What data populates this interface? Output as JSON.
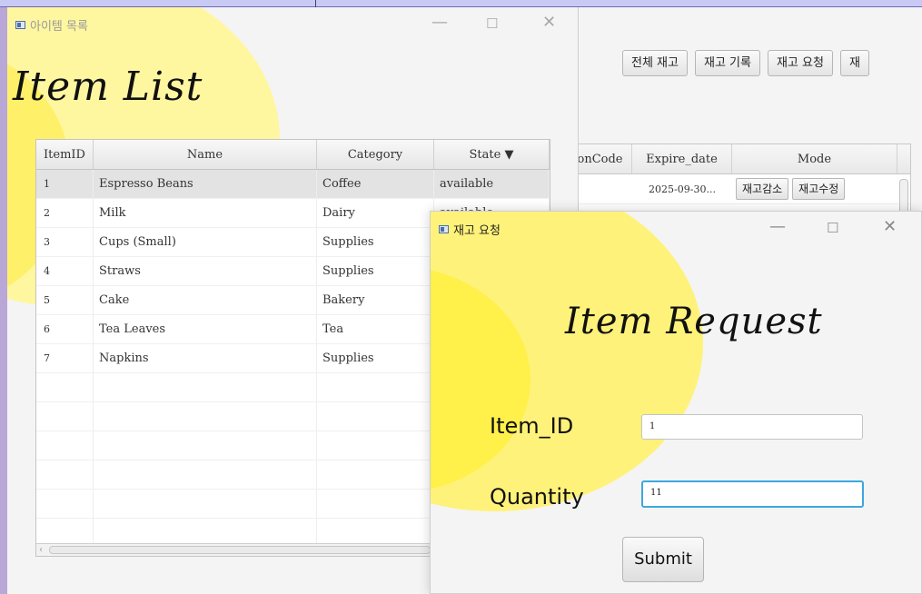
{
  "background_window": {
    "toolbar_buttons": [
      "전체 재고",
      "재고 기록",
      "재고 요청",
      "재"
    ],
    "table_headers": [
      "onCode",
      "Expire_date",
      "Mode"
    ],
    "first_row": {
      "expire_date": "2025-09-30...",
      "decrease_button": "재고감소",
      "edit_button": "재고수정"
    }
  },
  "item_window": {
    "title": "아이템 목록",
    "heading": "Item List",
    "controls": {
      "minimize": "—",
      "maximize": "☐",
      "close": "✕"
    },
    "columns": {
      "id": "ItemID",
      "name": "Name",
      "category": "Category",
      "state": "State ▼"
    },
    "rows": [
      {
        "id": "1",
        "name": "Espresso Beans",
        "category": "Coffee",
        "state": "available"
      },
      {
        "id": "2",
        "name": "Milk",
        "category": "Dairy",
        "state": "available"
      },
      {
        "id": "3",
        "name": "Cups (Small)",
        "category": "Supplies",
        "state": ""
      },
      {
        "id": "4",
        "name": "Straws",
        "category": "Supplies",
        "state": ""
      },
      {
        "id": "5",
        "name": "Cake",
        "category": "Bakery",
        "state": ""
      },
      {
        "id": "6",
        "name": "Tea Leaves",
        "category": "Tea",
        "state": ""
      },
      {
        "id": "7",
        "name": "Napkins",
        "category": "Supplies",
        "state": ""
      }
    ],
    "selected_row": 0,
    "scroll_left_arrow": "‹"
  },
  "request_window": {
    "title": "재고 요청",
    "heading": "Item Request",
    "controls": {
      "minimize": "—",
      "maximize": "☐",
      "close": "✕"
    },
    "item_id_label": "Item_ID",
    "item_id_value": "1",
    "quantity_label": "Quantity",
    "quantity_value": "11",
    "submit_label": "Submit"
  },
  "colors": {
    "circle_light": "#fff9a6",
    "circle_mid": "#fff27a",
    "circle_bright": "#fff04a",
    "focus_border": "#3da8e0"
  }
}
